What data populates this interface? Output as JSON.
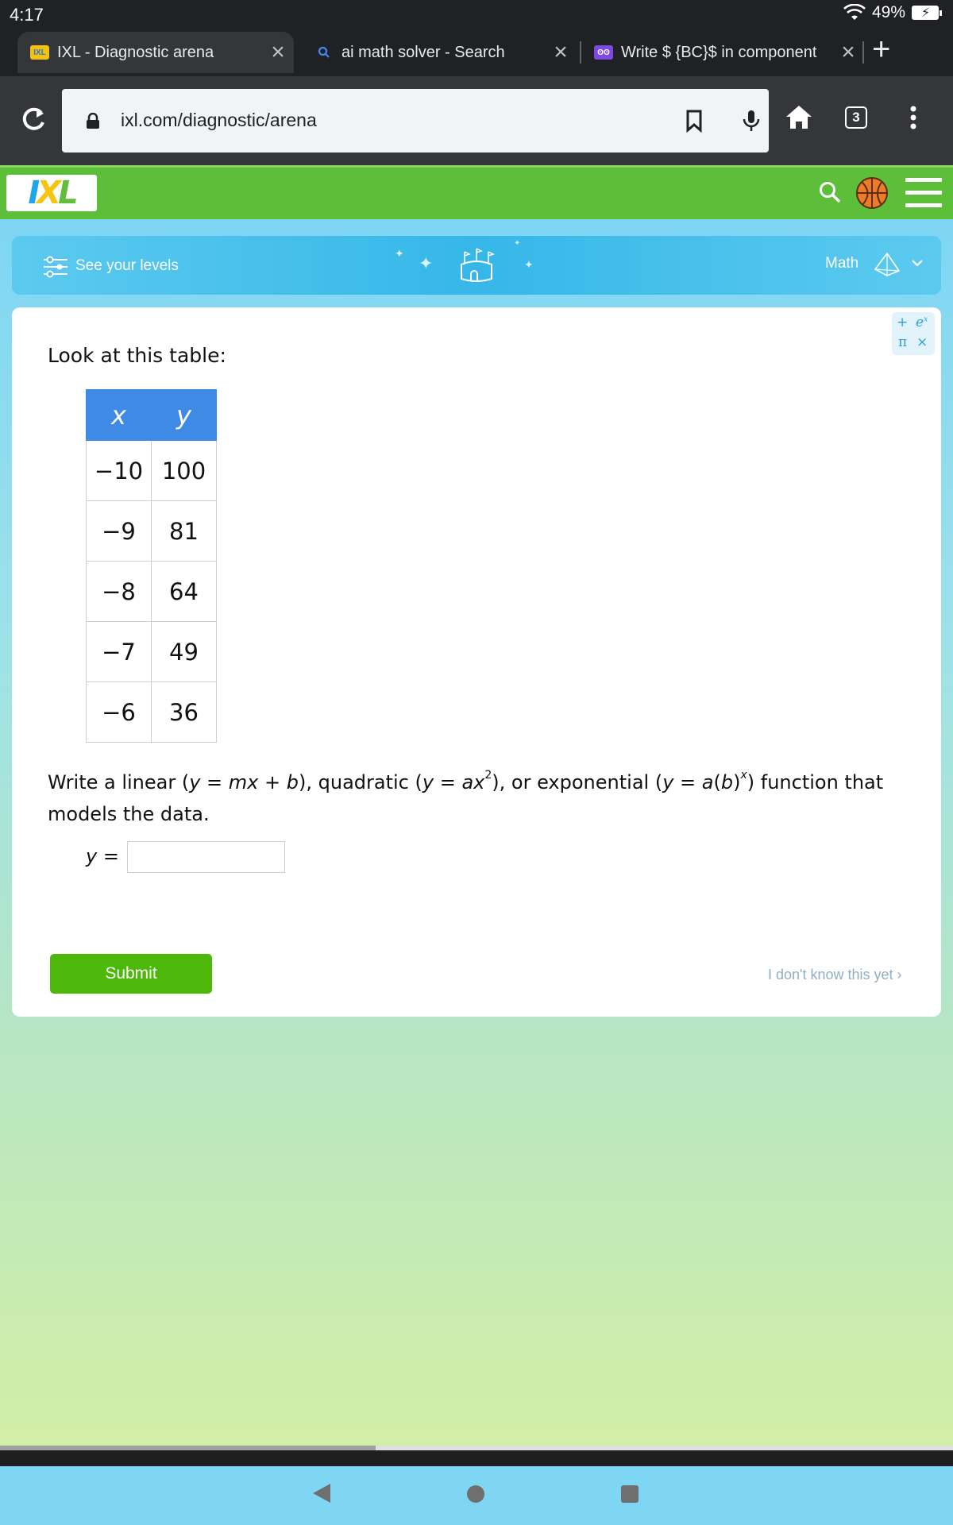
{
  "status": {
    "time": "4:17",
    "battery": "49%"
  },
  "tabs": [
    {
      "title": "IXL - Diagnostic arena",
      "favicon": "ixl-favicon"
    },
    {
      "title": "ai math solver - Search",
      "favicon": "search-favicon"
    },
    {
      "title": "Write $ {BC}$ in component",
      "favicon": "owl-favicon"
    }
  ],
  "toolbar": {
    "url": "ixl.com/diagnostic/arena",
    "tab_count": "3"
  },
  "ixl": {
    "logo_text": "IXL",
    "levels_label": "See your levels",
    "subject": "Math"
  },
  "question": {
    "prompt": "Look at this table:",
    "table": {
      "headers": [
        "x",
        "y"
      ],
      "rows": [
        [
          "−10",
          "100"
        ],
        [
          "−9",
          "81"
        ],
        [
          "−8",
          "64"
        ],
        [
          "−7",
          "49"
        ],
        [
          "−6",
          "36"
        ]
      ]
    },
    "answer_label": "y =",
    "answer_value": "",
    "submit_label": "Submit",
    "dont_know_label": "I don't know this yet ›"
  },
  "colors": {
    "ixl_green": "#5cbe39",
    "table_header": "#3f8ae4",
    "submit_green": "#4db80a"
  }
}
